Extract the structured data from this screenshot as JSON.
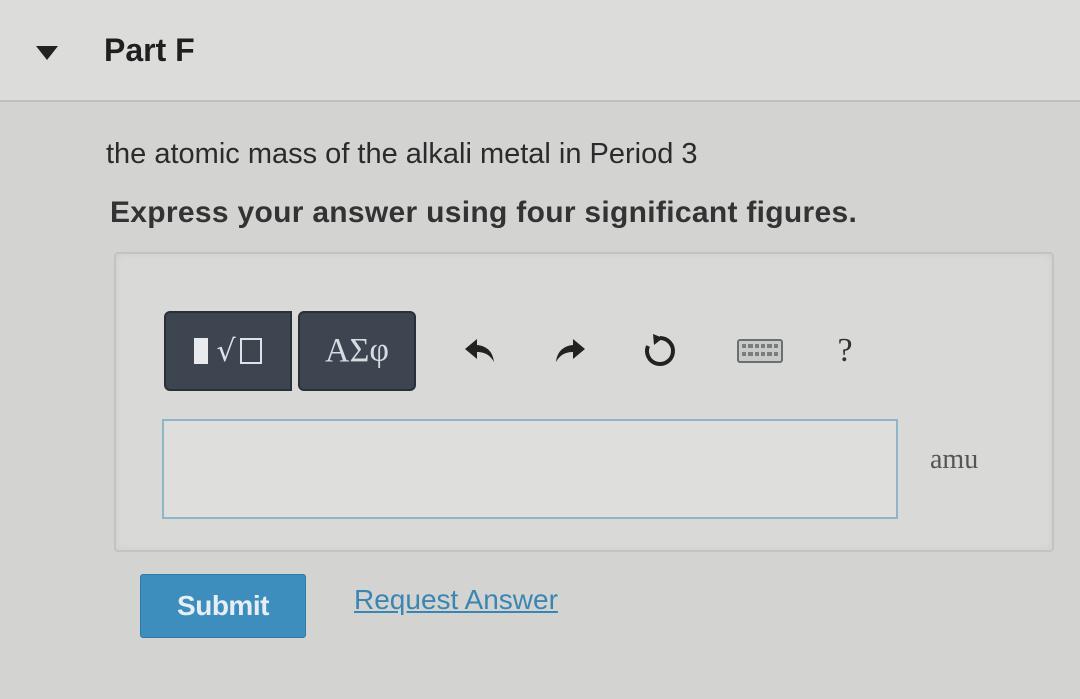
{
  "part": {
    "title": "Part F",
    "collapse_icon": "triangle-down-icon"
  },
  "question": {
    "text": "the atomic mass of the alkali metal in Period 3",
    "instruction": "Express your answer using four significant figures."
  },
  "toolbar": {
    "template_icon": "math-templates-icon",
    "symbols_label": "ΑΣφ",
    "undo_icon": "undo-arrow-icon",
    "redo_icon": "redo-arrow-icon",
    "reset_icon": "reset-icon",
    "keyboard_icon": "keyboard-icon",
    "help_label": "?"
  },
  "answer": {
    "value": "",
    "placeholder": "",
    "unit": "amu"
  },
  "actions": {
    "submit_label": "Submit",
    "request_answer_label": "Request Answer"
  },
  "colors": {
    "submit_button": "#3d8ebd",
    "link": "#3a86b3",
    "toolbar_button": "#3d4551"
  }
}
